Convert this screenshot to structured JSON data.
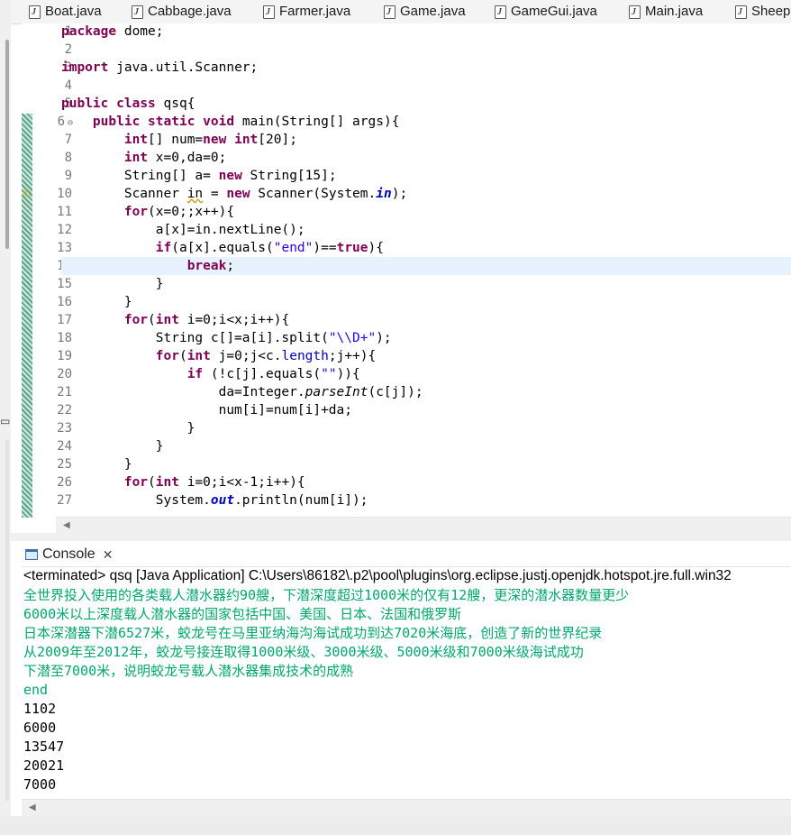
{
  "tabs": [
    {
      "label": "Boat.java"
    },
    {
      "label": "Cabbage.java"
    },
    {
      "label": "Farmer.java"
    },
    {
      "label": "Game.java"
    },
    {
      "label": "GameGui.java"
    },
    {
      "label": "Main.java"
    },
    {
      "label": "Sheep"
    }
  ],
  "editor": {
    "line_numbers": [
      "1",
      "2",
      "3",
      "4",
      "5",
      "6",
      "7",
      "8",
      "9",
      "10",
      "11",
      "12",
      "13",
      "14",
      "15",
      "16",
      "17",
      "18",
      "19",
      "20",
      "21",
      "22",
      "23",
      "24",
      "25",
      "26",
      "27"
    ],
    "current_line": "14"
  },
  "console": {
    "tab_label": "Console",
    "terminated_line": "<terminated> qsq [Java Application] C:\\Users\\86182\\.p2\\pool\\plugins\\org.eclipse.justj.openjdk.hotspot.jre.full.win32",
    "input_lines": [
      "全世界投入使用的各类载人潜水器约90艘，下潜深度超过1000米的仅有12艘，更深的潜水器数量更少",
      "6000米以上深度载人潜水器的国家包括中国、美国、日本、法国和俄罗斯",
      "日本深潜器下潜6527米，蛟龙号在马里亚纳海沟海试成功到达7020米海底，创造了新的世界纪录",
      "从2009年至2012年，蛟龙号接连取得1000米级、3000米级、5000米级和7000米级海试成功",
      "下潜至7000米，说明蛟龙号载人潜水器集成技术的成熟",
      "end"
    ],
    "output_lines": [
      "1102",
      "6000",
      "13547",
      "20021",
      "7000"
    ]
  },
  "colors": {
    "keyword": "#7f0055",
    "string": "#2a00ff",
    "field": "#0000c0",
    "console_input": "#00a86b",
    "current_line": "#e8f2fe"
  }
}
